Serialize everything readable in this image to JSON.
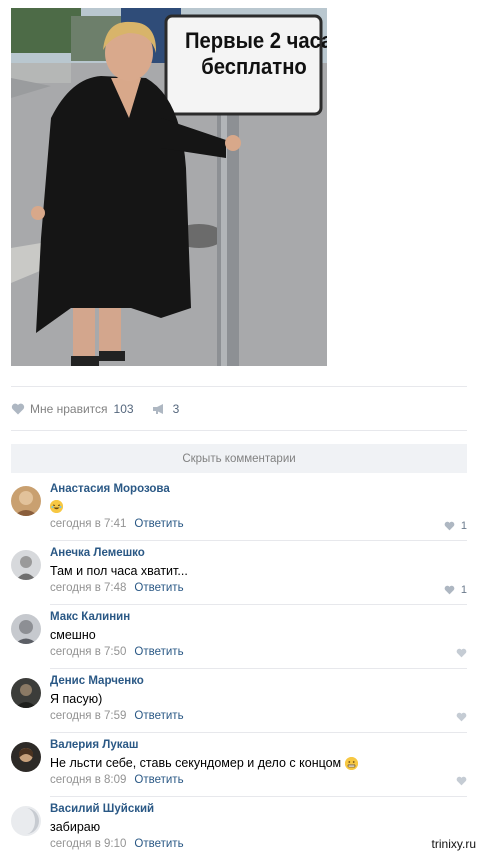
{
  "post": {
    "photo_sign_line1": "Первые 2 часа",
    "photo_sign_line2": "бесплатно",
    "likes_label": "Мне нравится",
    "likes_count": "103",
    "shares_count": "3"
  },
  "hide_comments_label": "Скрыть комментарии",
  "comments": [
    {
      "author": "Анастасия Морозова",
      "text": "",
      "emoji": "laughing-emoji",
      "time": "сегодня в 7:41",
      "reply": "Ответить",
      "likes": "1"
    },
    {
      "author": "Анечка Лемешко",
      "text": "Там и пол часа хватит...",
      "time": "сегодня в 7:48",
      "reply": "Ответить",
      "likes": "1"
    },
    {
      "author": "Макс Калинин",
      "text": "смешно",
      "time": "сегодня в 7:50",
      "reply": "Ответить",
      "likes": ""
    },
    {
      "author": "Денис Марченко",
      "text": "Я пасую)",
      "time": "сегодня в 7:59",
      "reply": "Ответить",
      "likes": ""
    },
    {
      "author": "Валерия Лукаш",
      "text": "Не льсти себе, ставь секундомер и дело с концом",
      "emoji": "grimace-emoji",
      "time": "сегодня в 8:09",
      "reply": "Ответить",
      "likes": ""
    },
    {
      "author": "Василий Шуйский",
      "text": "забираю",
      "time": "сегодня в 9:10",
      "reply": "Ответить",
      "likes": ""
    }
  ],
  "watermark": "trinixy.ru",
  "colors": {
    "link": "#2a5885",
    "meta": "#939393",
    "button_bg": "#f0f2f5"
  }
}
